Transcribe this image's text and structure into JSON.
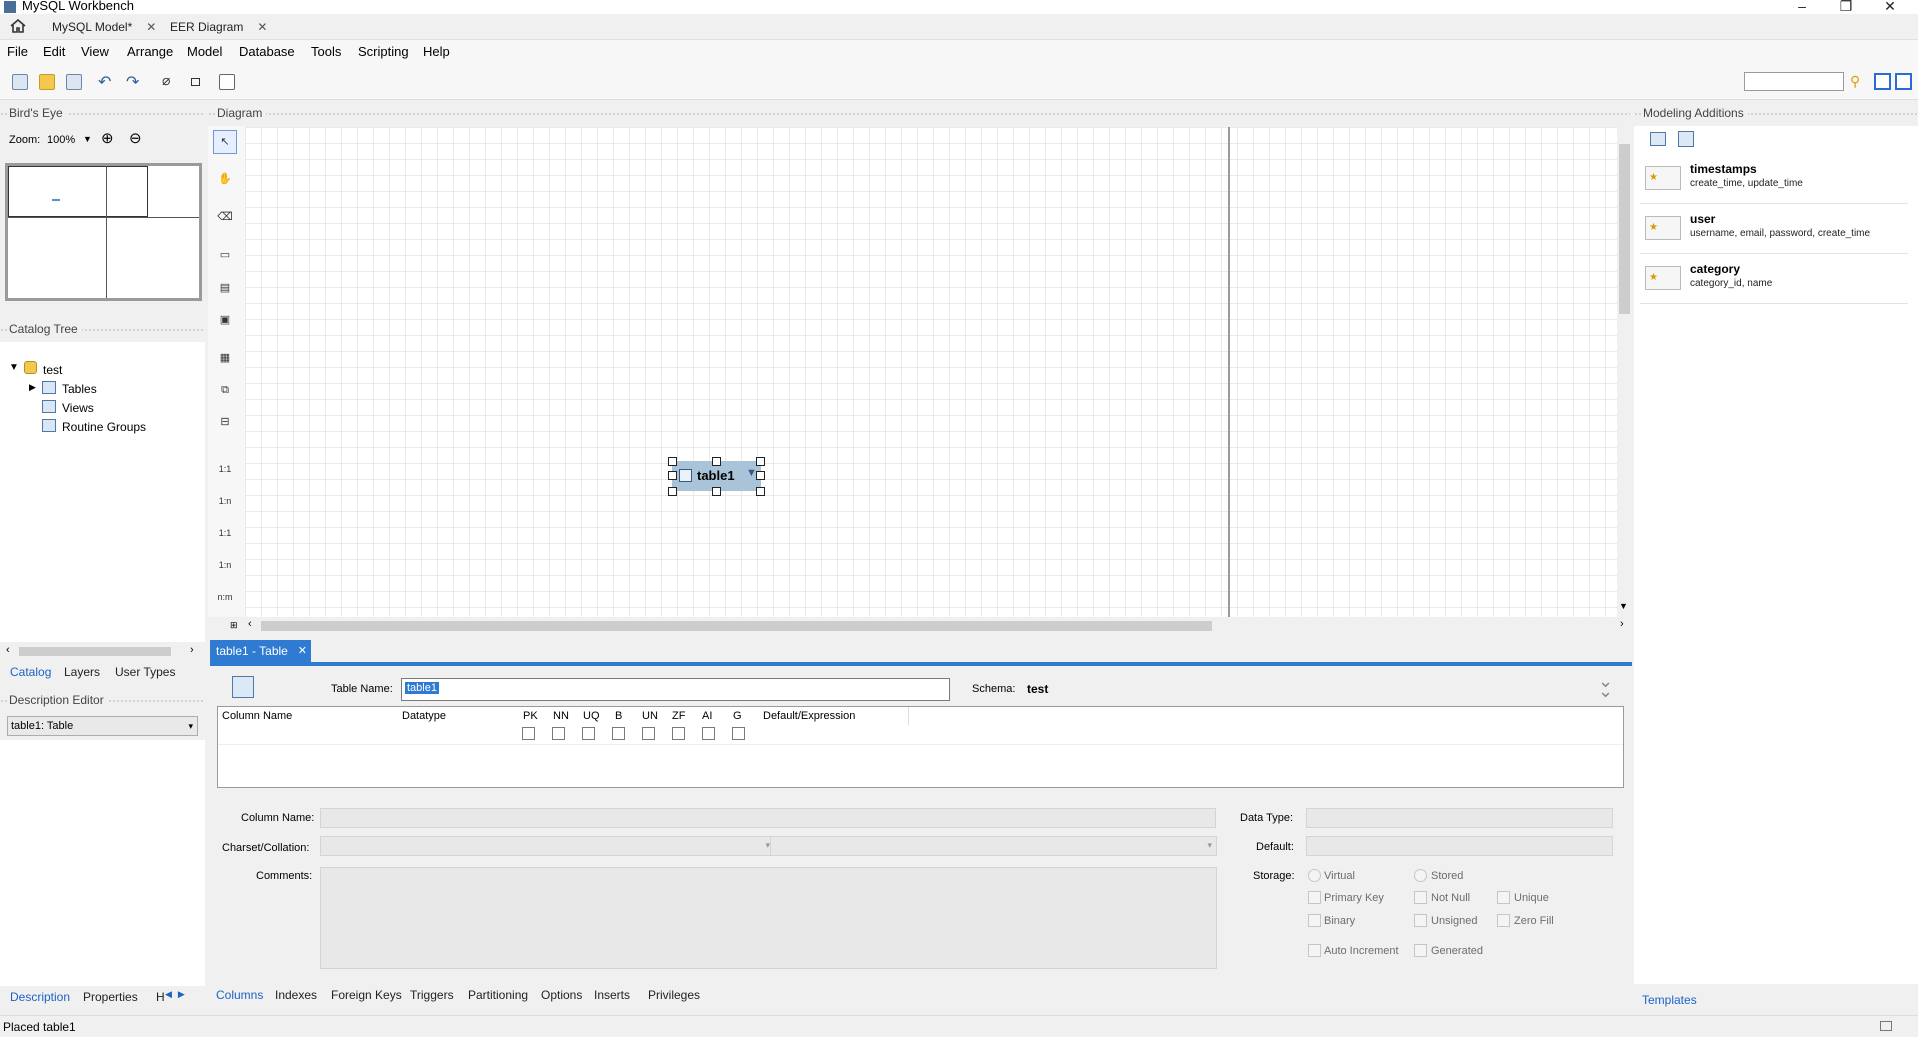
{
  "window": {
    "title": "MySQL Workbench",
    "minimize": "–",
    "restore": "❐",
    "close": "✕"
  },
  "tabs": [
    {
      "label": "MySQL Model*"
    },
    {
      "label": "EER Diagram"
    }
  ],
  "menu": [
    "File",
    "Edit",
    "View",
    "Arrange",
    "Model",
    "Database",
    "Tools",
    "Scripting",
    "Help"
  ],
  "birds_eye": {
    "title": "Bird's Eye",
    "zoom_label": "Zoom:",
    "zoom_value": "100%"
  },
  "catalog_tree": {
    "title": "Catalog Tree",
    "schema": "test",
    "items": [
      "Tables",
      "Views",
      "Routine Groups"
    ]
  },
  "left_tabs": [
    "Catalog",
    "Layers",
    "User Types"
  ],
  "description_editor": {
    "title": "Description Editor",
    "selected": "table1: Table"
  },
  "left_bottom_tabs": [
    "Description",
    "Properties",
    "H"
  ],
  "diagram": {
    "title": "Diagram",
    "table_name": "table1"
  },
  "tools": {
    "rel_11": "1:1",
    "rel_1n": "1:n",
    "rel_11b": "1:1",
    "rel_1nb": "1:n",
    "rel_nm": "n:m"
  },
  "editor": {
    "tab_label": "table1 - Table",
    "tab_close": "✕",
    "table_name_label": "Table Name:",
    "table_name_value": "table1",
    "schema_label": "Schema:",
    "schema_value": "test",
    "columns": [
      "Column Name",
      "Datatype",
      "PK",
      "NN",
      "UQ",
      "B",
      "UN",
      "ZF",
      "AI",
      "G",
      "Default/Expression"
    ],
    "column_name_label": "Column Name:",
    "data_type_label": "Data Type:",
    "charset_label": "Charset/Collation:",
    "default_label": "Default:",
    "comments_label": "Comments:",
    "storage_label": "Storage:",
    "storage_options": [
      "Virtual",
      "Stored"
    ],
    "flags": [
      "Primary Key",
      "Not Null",
      "Unique",
      "Binary",
      "Unsigned",
      "Zero Fill",
      "Auto Increment",
      "Generated"
    ],
    "bottom_tabs": [
      "Columns",
      "Indexes",
      "Foreign Keys",
      "Triggers",
      "Partitioning",
      "Options",
      "Inserts",
      "Privileges"
    ]
  },
  "modeling_additions": {
    "title": "Modeling Additions",
    "templates_tab": "Templates",
    "items": [
      {
        "name": "timestamps",
        "desc": "create_time, update_time"
      },
      {
        "name": "user",
        "desc": "username, email, password, create_time"
      },
      {
        "name": "category",
        "desc": "category_id, name"
      }
    ]
  },
  "status": {
    "text": "Placed table1"
  }
}
